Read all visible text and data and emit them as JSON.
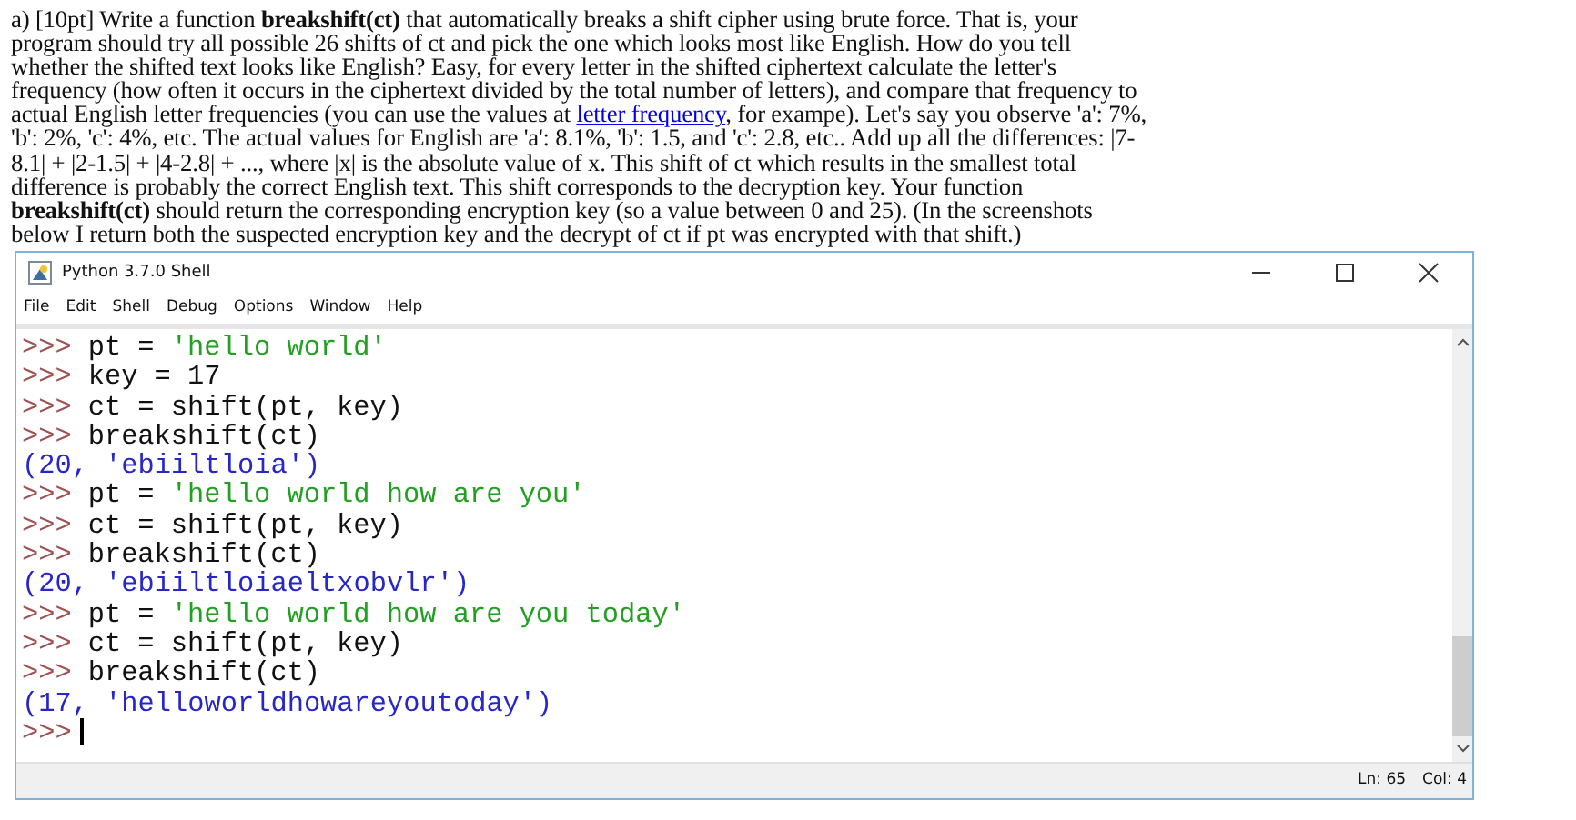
{
  "question": {
    "before_link": "a) [10pt] Write a function **breakshift(ct)** that automatically breaks a shift cipher using brute force. That is, your program should try all possible 26 shifts of ct and pick the one which looks most like English. How do you tell whether the shifted text looks like English? Easy, for every letter in the shifted ciphertext calculate the letter's frequency (how often it occurs in the ciphertext divided by the total number of letters), and compare that frequency to actual English letter frequencies (you can use the values at",
    "link": "letter frequency",
    "after_link": ", for exampe). Let's say you observe 'a': 7%, 'b': 2%, 'c': 4%, etc. The actual values for English are 'a': 8.1%, 'b': 1.5, and 'c': 2.8, etc.. Add up all the differences: |7-8.1| + |2-1.5| + |4-2.8| + ..., where |x| is the absolute value of x. This shift of ct which results in the smallest total difference is probably the correct English text. This shift corresponds to the decryption key. Your function **breakshift(ct)** should return the corresponding encryption key (so a value between 0 and 25). (In the screenshots below I return both the suspected encryption key and the decrypt of ct if pt was encrypted with that shift.)"
  },
  "window": {
    "title": "Python 3.7.0 Shell"
  },
  "menu": [
    {
      "label": "File"
    },
    {
      "label": "Edit"
    },
    {
      "label": "Shell"
    },
    {
      "label": "Debug"
    },
    {
      "label": "Options"
    },
    {
      "label": "Window"
    },
    {
      "label": "Help"
    }
  ],
  "lines": [
    {
      "prompt": ">>>",
      "segments": [
        {
          "text": "pt = ",
          "kind": "code"
        },
        {
          "text": "'hello world'",
          "kind": "string"
        }
      ]
    },
    {
      "prompt": ">>>",
      "segments": [
        {
          "text": "key = 17",
          "kind": "code"
        }
      ]
    },
    {
      "prompt": ">>>",
      "segments": [
        {
          "text": "ct = shift(pt, key)",
          "kind": "code"
        }
      ]
    },
    {
      "prompt": ">>>",
      "segments": [
        {
          "text": "breakshift(ct)",
          "kind": "code"
        }
      ]
    },
    {
      "segments": [
        {
          "text": "(20, 'ebiiltloia')",
          "kind": "output"
        }
      ]
    },
    {
      "prompt": ">>>",
      "segments": [
        {
          "text": "pt = ",
          "kind": "code"
        },
        {
          "text": "'hello world how are you'",
          "kind": "string"
        }
      ]
    },
    {
      "prompt": ">>>",
      "segments": [
        {
          "text": "ct = shift(pt, key)",
          "kind": "code"
        }
      ]
    },
    {
      "prompt": ">>>",
      "segments": [
        {
          "text": "breakshift(ct)",
          "kind": "code"
        }
      ]
    },
    {
      "segments": [
        {
          "text": "(20, 'ebiiltloiaeltxobvlr')",
          "kind": "output"
        }
      ]
    },
    {
      "prompt": ">>>",
      "segments": [
        {
          "text": "pt = ",
          "kind": "code"
        },
        {
          "text": "'hello world how are you today'",
          "kind": "string"
        }
      ]
    },
    {
      "prompt": ">>>",
      "segments": [
        {
          "text": "ct = shift(pt, key)",
          "kind": "code"
        }
      ]
    },
    {
      "prompt": ">>>",
      "segments": [
        {
          "text": "breakshift(ct)",
          "kind": "code"
        }
      ]
    },
    {
      "segments": [
        {
          "text": "(17, 'helloworldhowareyoutoday')",
          "kind": "output"
        }
      ]
    },
    {
      "prompt": ">>>",
      "cursor": true
    }
  ],
  "status_bar": {
    "line": "Ln: 65",
    "column": "Col: 4"
  }
}
